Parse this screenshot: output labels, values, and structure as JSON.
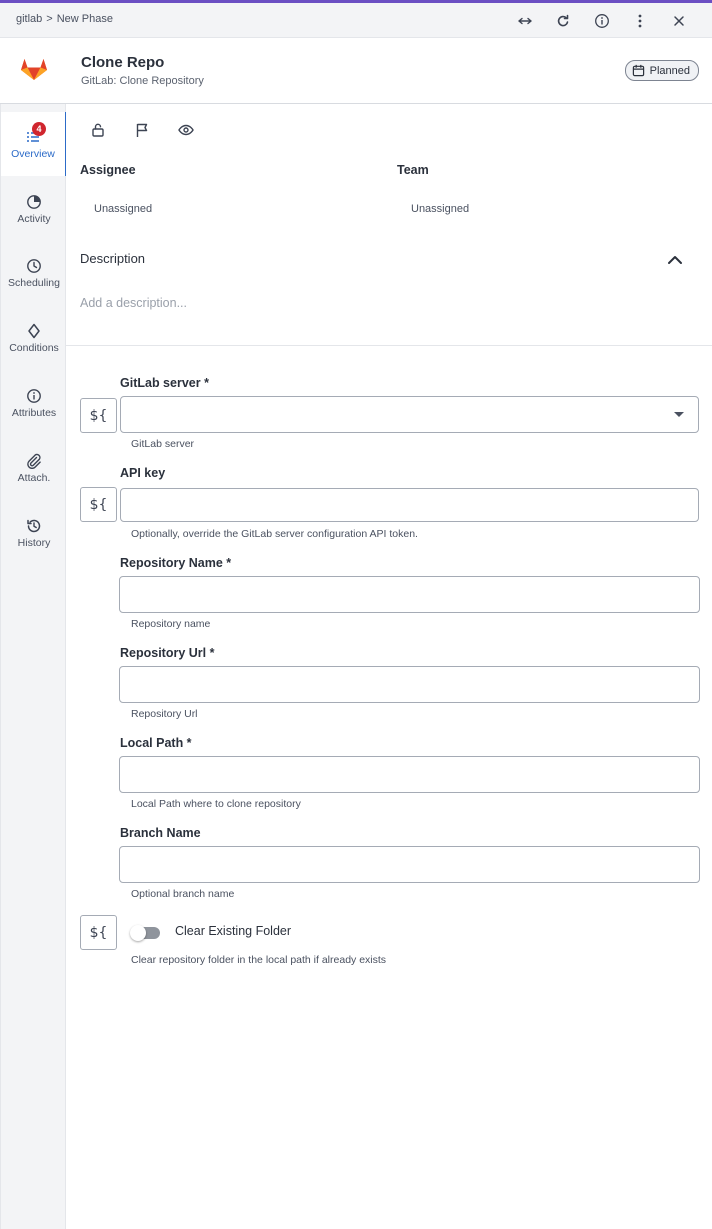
{
  "breadcrumb": {
    "root": "gitlab",
    "separator": ">",
    "current": "New Phase"
  },
  "top_icons": [
    "expand-horizontal-icon",
    "refresh-icon",
    "info-icon",
    "more-vertical-icon",
    "close-icon"
  ],
  "header": {
    "title": "Clone Repo",
    "subtitle": "GitLab: Clone Repository",
    "status": "Planned"
  },
  "sidebar": {
    "items": [
      {
        "label": "Overview",
        "icon": "list-icon",
        "badge": "4",
        "active": true
      },
      {
        "label": "Activity",
        "icon": "pie-chart-icon"
      },
      {
        "label": "Scheduling",
        "icon": "clock-icon"
      },
      {
        "label": "Conditions",
        "icon": "diamond-icon"
      },
      {
        "label": "Attributes",
        "icon": "info-icon"
      },
      {
        "label": "Attach.",
        "icon": "paperclip-icon"
      },
      {
        "label": "History",
        "icon": "history-icon"
      }
    ]
  },
  "overview": {
    "toolbar_icons": [
      "unlock-icon",
      "flag-icon",
      "eye-icon"
    ],
    "assignee_label": "Assignee",
    "assignee_value": "Unassigned",
    "team_label": "Team",
    "team_value": "Unassigned",
    "description_label": "Description",
    "description_placeholder": "Add a description..."
  },
  "form": {
    "expr_label": "${",
    "gitlab_server": {
      "label": "GitLab server *",
      "value": "",
      "helper": "GitLab server"
    },
    "api_key": {
      "label": "API key",
      "value": "",
      "helper": "Optionally, override the GitLab server configuration API token."
    },
    "repository_name": {
      "label": "Repository Name *",
      "value": "",
      "helper": "Repository name"
    },
    "repository_url": {
      "label": "Repository Url *",
      "value": "",
      "helper": "Repository Url"
    },
    "local_path": {
      "label": "Local Path *",
      "value": "",
      "helper": "Local Path where to clone repository"
    },
    "branch_name": {
      "label": "Branch Name",
      "value": "",
      "helper": "Optional branch name"
    },
    "clear_existing_folder": {
      "label": "Clear Existing Folder",
      "checked": false,
      "helper": "Clear repository folder in the local path if already exists"
    }
  },
  "colors": {
    "accent": "#6b4fc3",
    "active_nav": "#2c6bc8",
    "badge": "#d0262e",
    "logo_orange": "#e24329"
  }
}
